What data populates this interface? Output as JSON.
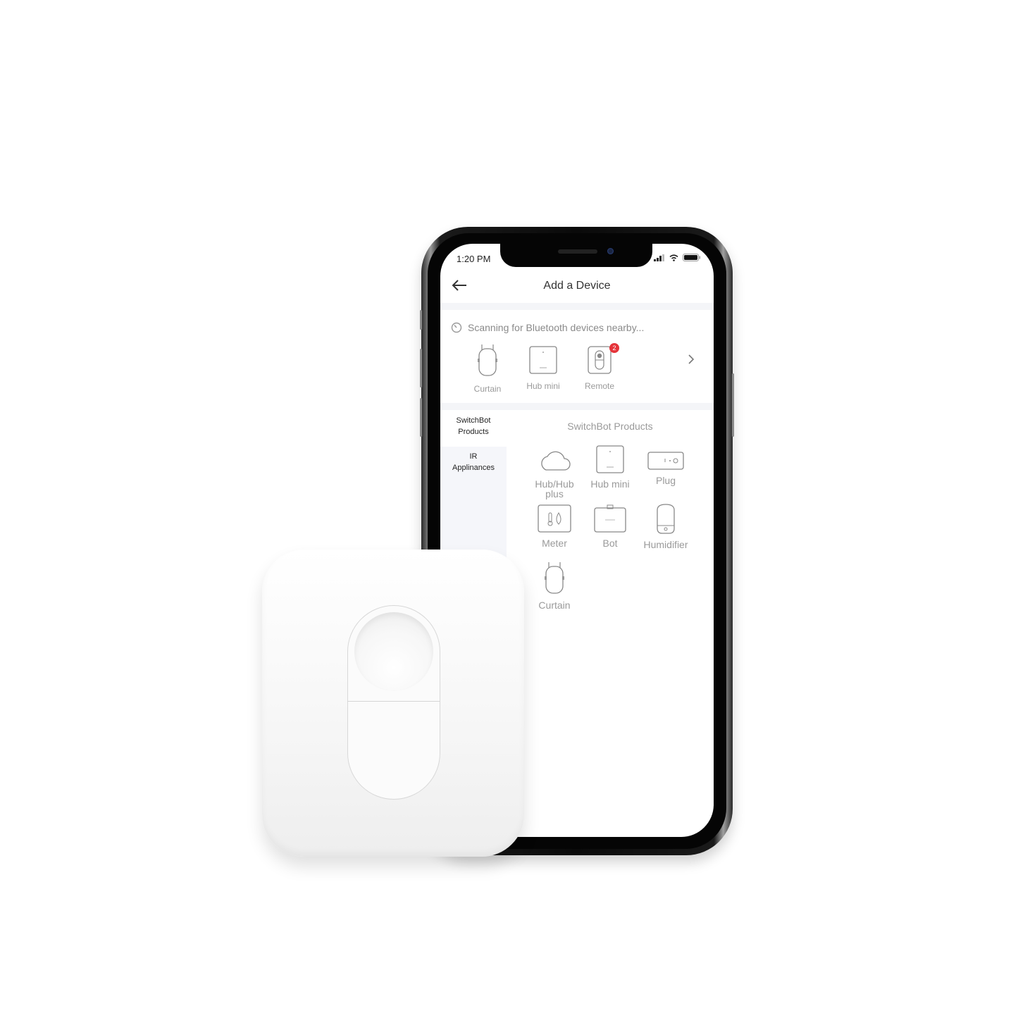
{
  "status_bar": {
    "time": "1:20 PM"
  },
  "header": {
    "title": "Add a Device",
    "back_label": "←"
  },
  "scan": {
    "text": "Scanning for Bluetooth devices nearby...",
    "devices": [
      {
        "label": "Curtain",
        "icon": "curtain-icon"
      },
      {
        "label": "Hub mini",
        "icon": "hub-mini-icon"
      },
      {
        "label": "Remote",
        "icon": "remote-icon",
        "badge": "2"
      }
    ],
    "more": "›"
  },
  "sidebar": {
    "tabs": [
      {
        "line1": "SwitchBot",
        "line2": "Products",
        "active": true
      },
      {
        "line1": "IR",
        "line2": "Applinances",
        "active": false
      }
    ]
  },
  "products": {
    "title": "SwitchBot Products",
    "items": [
      {
        "label": "Hub/Hub",
        "label2": "plus",
        "icon": "cloud-icon"
      },
      {
        "label": "Hub mini",
        "icon": "hub-mini-icon"
      },
      {
        "label": "Plug",
        "icon": "plug-icon"
      },
      {
        "label": "Meter",
        "icon": "meter-icon"
      },
      {
        "label": "Bot",
        "icon": "bot-icon"
      },
      {
        "label": "Humidifier",
        "icon": "humidifier-icon"
      },
      {
        "label": "Curtain",
        "icon": "curtain-icon"
      }
    ]
  },
  "colors": {
    "badge": "#e5343a",
    "muted_text": "#9a9a9a"
  }
}
